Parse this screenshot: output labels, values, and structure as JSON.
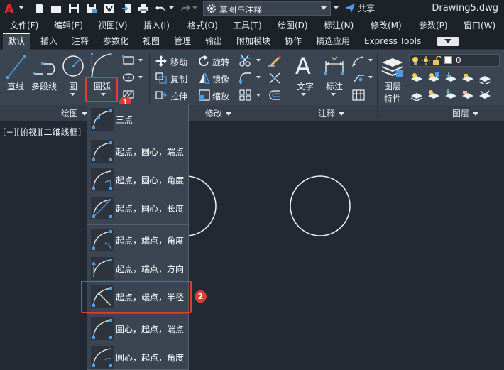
{
  "titlebar": {
    "app_logo": "A",
    "workspace": "草图与注释",
    "share": "共享",
    "document": "Drawing5.dwg"
  },
  "menu": [
    "文件(F)",
    "编辑(E)",
    "视图(V)",
    "插入(I)",
    "格式(O)",
    "工具(T)",
    "绘图(D)",
    "标注(N)",
    "修改(M)",
    "参数(P)",
    "窗口(W)"
  ],
  "tabs": [
    "默认",
    "插入",
    "注释",
    "参数化",
    "视图",
    "管理",
    "输出",
    "附加模块",
    "协作",
    "精选应用",
    "Express Tools"
  ],
  "active_tab": "默认",
  "ribbon": {
    "draw": {
      "title": "绘图",
      "line": "直线",
      "polyline": "多段线",
      "circle": "圆",
      "arc": "圆弧"
    },
    "modify": {
      "title": "修改",
      "move": "移动",
      "rotate": "旋转",
      "copy": "复制",
      "mirror": "镜像",
      "stretch": "拉伸",
      "scale": "缩放"
    },
    "annotation": {
      "title": "注释",
      "text": "文字",
      "dimension": "标注"
    },
    "layers": {
      "title": "图层",
      "properties_line1": "图层",
      "properties_line2": "特性",
      "current_layer": "0"
    }
  },
  "viewport_label": "[−][俯视][二维线框]",
  "arc_dropdown": [
    "三点",
    "起点，圆心，端点",
    "起点，圆心，角度",
    "起点，圆心，长度",
    "起点，端点，角度",
    "起点，端点，方向",
    "起点，端点，半径",
    "圆心，起点，端点",
    "圆心，起点，角度"
  ],
  "callouts": [
    "1",
    "2"
  ],
  "colors": {
    "accent_red": "#e03c31",
    "ribbon_bg": "#3b4551",
    "canvas_bg": "#222933",
    "icon_blue": "#4f9be0"
  }
}
